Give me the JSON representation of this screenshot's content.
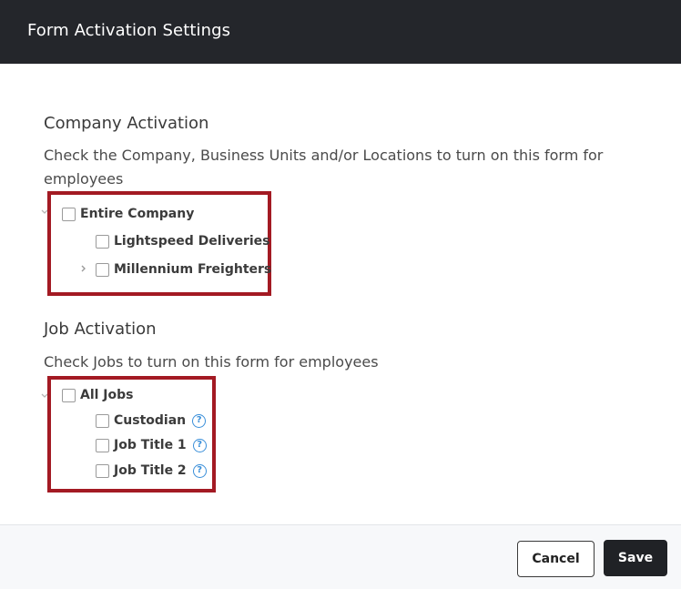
{
  "modal": {
    "title": "Form Activation Settings"
  },
  "company_activation": {
    "heading": "Company Activation",
    "description": "Check the Company, Business Units and/or Locations to turn on this form for employees",
    "tree": {
      "root": {
        "label": "Entire Company",
        "checked": false
      },
      "children": [
        {
          "label": "Lightspeed Deliveries",
          "checked": false,
          "expandable": false
        },
        {
          "label": "Millennium Freighters",
          "checked": false,
          "expandable": true
        }
      ]
    }
  },
  "job_activation": {
    "heading": "Job Activation",
    "description": "Check Jobs to turn on this form for employees",
    "tree": {
      "root": {
        "label": "All Jobs",
        "checked": false
      },
      "children": [
        {
          "label": "Custodian",
          "checked": false,
          "help_icon": "question-circle-icon"
        },
        {
          "label": "Job Title 1",
          "checked": false,
          "help_icon": "question-circle-icon"
        },
        {
          "label": "Job Title 2",
          "checked": false,
          "help_icon": "question-circle-icon"
        }
      ]
    }
  },
  "footer": {
    "cancel_label": "Cancel",
    "save_label": "Save"
  },
  "icons": {
    "help_glyph": "?"
  },
  "colors": {
    "header_bg": "#24262b",
    "highlight_border": "#a31a23",
    "help_icon": "#3a8fd9",
    "save_bg": "#202226"
  }
}
